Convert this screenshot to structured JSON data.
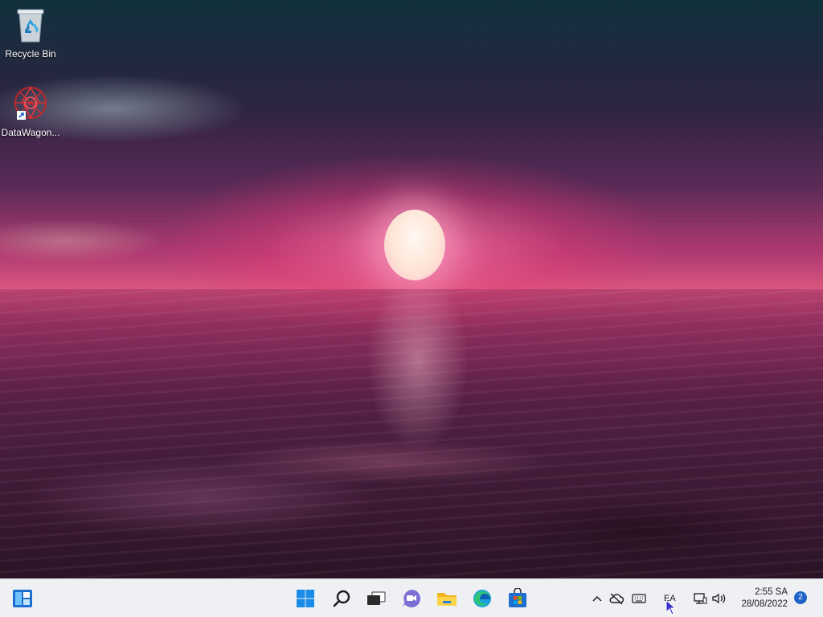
{
  "desktop": {
    "icons": [
      {
        "label": "Recycle Bin",
        "icon": "recycle-bin-icon"
      },
      {
        "label": "DataWagon...",
        "icon": "datawagon-app-icon",
        "shortcut": true
      }
    ]
  },
  "taskbar": {
    "left": {
      "icon": "widgets-icon"
    },
    "apps": [
      {
        "name": "start-button",
        "icon": "windows-logo-icon"
      },
      {
        "name": "search-button",
        "icon": "search-icon"
      },
      {
        "name": "task-view-button",
        "icon": "task-view-icon"
      },
      {
        "name": "chat-button",
        "icon": "chat-icon"
      },
      {
        "name": "file-explorer-button",
        "icon": "folder-icon"
      },
      {
        "name": "edge-button",
        "icon": "edge-icon"
      },
      {
        "name": "store-button",
        "icon": "store-icon"
      }
    ],
    "tray": {
      "language": "EA",
      "time": "2:55 SA",
      "date": "28/08/2022",
      "notification_count": "2"
    }
  },
  "colors": {
    "taskbar_bg": "#eef0f4",
    "accent_blue": "#1f63c9",
    "windows_blue": "#1a8ce8"
  }
}
